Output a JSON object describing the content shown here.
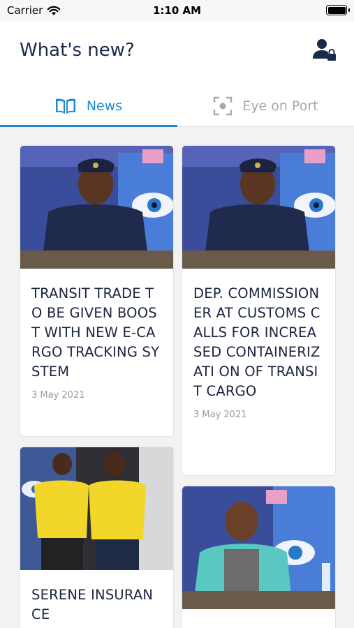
{
  "status_bar": {
    "carrier": "Carrier",
    "time": "1:10 AM"
  },
  "header": {
    "title": "What's new?",
    "account_icon": "user-lock-icon"
  },
  "tabs": [
    {
      "label": "News",
      "icon": "book-open-icon",
      "active": true
    },
    {
      "label": "Eye on Port",
      "icon": "focus-scan-icon",
      "active": false
    }
  ],
  "news": [
    {
      "title": "TRANSIT TRADE TO BE GIVEN BOOST WITH NEW E-CARGO TRACKING SYSTEM",
      "date": "3 May 2021"
    },
    {
      "title": "DEP. COMMISSIONER AT CUSTOMS CALLS FOR INCREASED CONTAINERIZATI ON OF TRANSIT CARGO",
      "date": "3 May 2021"
    },
    {
      "title": "SERENE INSURANCE"
    },
    {
      "title": ""
    }
  ],
  "colors": {
    "accent": "#1e88d6",
    "title": "#1a2a4a",
    "inactive": "#a8a8a8"
  }
}
